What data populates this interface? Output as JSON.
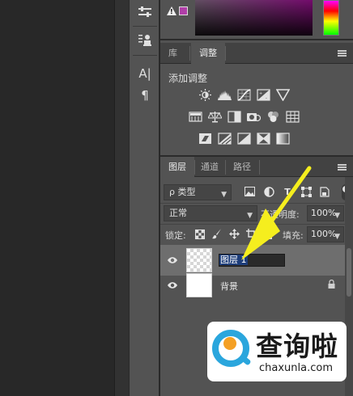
{
  "colors": {
    "panel_bg": "#535353",
    "tab_bg": "#424242",
    "canvas_bg": "#282828",
    "selected_layer": "#6e6e6e",
    "text_highlight": "#1d3d7a",
    "arrow": "#f5ee1e",
    "watermark_blue": "#2aa6dd",
    "watermark_orange": "#f4a024"
  },
  "toolstrip": {
    "char_tool_glyph": "A|",
    "paragraph_tool_glyph": "¶"
  },
  "color_panel": {
    "warning_glyph": "!"
  },
  "adjustments": {
    "tabs": [
      {
        "label": "库",
        "active": false
      },
      {
        "label": "调整",
        "active": true
      }
    ],
    "title": "添加调整",
    "icon_rows": [
      [
        "brightness-contrast-icon",
        "levels-icon",
        "curves-icon",
        "exposure-icon",
        "vibrance-icon"
      ],
      [
        "hue-saturation-icon",
        "color-balance-icon",
        "black-white-icon",
        "photo-filter-icon",
        "channel-mixer-icon",
        "color-lookup-icon"
      ],
      [
        "invert-icon",
        "posterize-icon",
        "threshold-icon",
        "selective-color-icon",
        "gradient-map-icon"
      ]
    ]
  },
  "layers": {
    "tabs": [
      {
        "label": "图层",
        "active": true
      },
      {
        "label": "通道",
        "active": false
      },
      {
        "label": "路径",
        "active": false
      }
    ],
    "filter_kind": "类型",
    "filter_icon_glyph": "ρ",
    "filter_type_icons": [
      "T"
    ],
    "blend_mode": "正常",
    "opacity_label": "不透明度:",
    "opacity_value": "100%",
    "lock_label": "锁定:",
    "fill_label": "填充:",
    "fill_value": "100%",
    "items": [
      {
        "name": "图层 1",
        "editing": true,
        "visible": true,
        "thumbnail": "transparent"
      },
      {
        "name": "背景",
        "editing": false,
        "visible": true,
        "thumbnail": "white",
        "locked": true
      }
    ]
  },
  "watermark": {
    "title": "查询啦",
    "url": "chaxunla.com"
  }
}
